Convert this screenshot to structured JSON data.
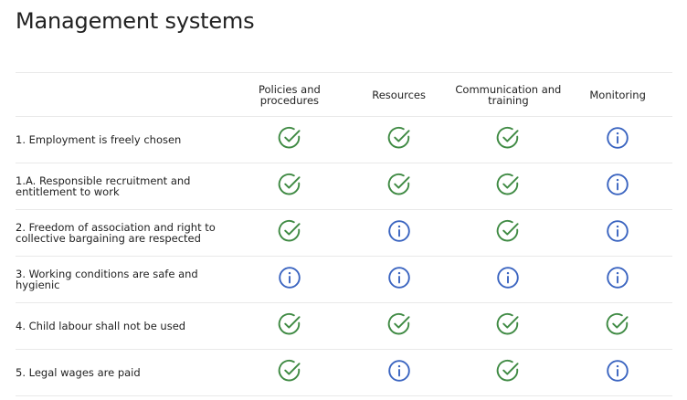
{
  "page": {
    "title": "Management systems"
  },
  "table": {
    "columns": [
      {
        "label": "Policies and procedures"
      },
      {
        "label": "Resources"
      },
      {
        "label": "Communication and training"
      },
      {
        "label": "Monitoring"
      }
    ],
    "rows": [
      {
        "label": "1. Employment is freely chosen",
        "statuses": [
          "check",
          "check",
          "check",
          "info"
        ]
      },
      {
        "label": "1.A. Responsible recruitment and entitlement to work",
        "statuses": [
          "check",
          "check",
          "check",
          "info"
        ]
      },
      {
        "label": "2. Freedom of association and right to collective bargaining are respected",
        "statuses": [
          "check",
          "info",
          "check",
          "info"
        ]
      },
      {
        "label": "3. Working conditions are safe and hygienic",
        "statuses": [
          "info",
          "info",
          "info",
          "info"
        ]
      },
      {
        "label": "4. Child labour shall not be used",
        "statuses": [
          "check",
          "check",
          "check",
          "check"
        ]
      },
      {
        "label": "5. Legal wages are paid",
        "statuses": [
          "check",
          "info",
          "check",
          "info"
        ]
      }
    ]
  },
  "icons": {
    "check": {
      "name": "check-circle-icon",
      "color": "#3f8a43"
    },
    "info": {
      "name": "info-circle-icon",
      "color": "#3a64c0"
    }
  }
}
